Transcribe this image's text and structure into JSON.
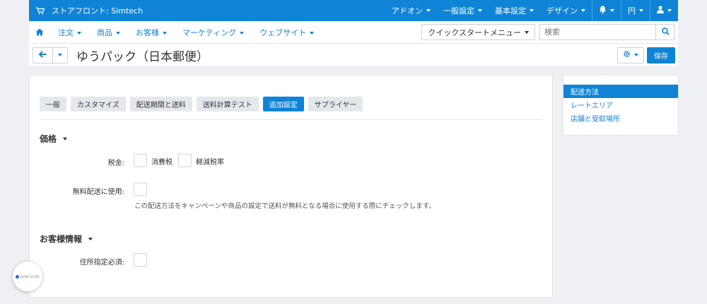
{
  "topbar": {
    "store_label": "ストアフロント: Simtech",
    "menus": [
      "アドオン",
      "一般設定",
      "基本設定",
      "デザイン"
    ],
    "currency": "円"
  },
  "nav": {
    "items": [
      "注文",
      "商品",
      "お客様",
      "マーケティング",
      "ウェブサイト"
    ],
    "quickstart": "クイックスタートメニュー",
    "search_placeholder": "検索"
  },
  "titlebar": {
    "title": "ゆうパック（日本郵便）",
    "save_label": "保存"
  },
  "tabs": [
    "一般",
    "カスタマイズ",
    "配送期間と送料",
    "送料計算テスト",
    "追加設定",
    "サプライヤー"
  ],
  "active_tab": "追加設定",
  "sections": {
    "price": {
      "heading": "価格",
      "tax_label": "税金:",
      "tax_options": [
        "消費税",
        "軽減税率"
      ],
      "free_shipping_label": "無料配送に使用:",
      "free_shipping_help": "この配送方法をキャンペーンや商品の設定で送料が無料となる場合に使用する際にチェックします。"
    },
    "customer": {
      "heading": "お客様情報",
      "address_required_label": "住所指定必須:"
    }
  },
  "sidebar": {
    "items": [
      "配送方法",
      "レートエリア",
      "店舗と受取場所"
    ],
    "active_index": 0
  },
  "badge": {
    "text": "DEMO STORE"
  },
  "colors": {
    "accent": "#0f84d6",
    "tab_bg": "#e4e8ec",
    "page_bg": "#eef0f3"
  }
}
